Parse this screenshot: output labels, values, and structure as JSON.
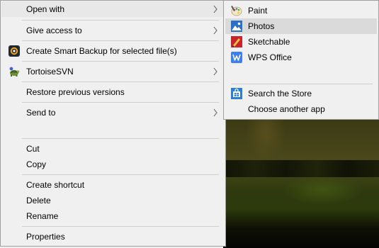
{
  "context_menu": {
    "items": [
      {
        "label": "Open with",
        "has_submenu": true,
        "icon": null,
        "highlighted": true
      },
      {
        "label": "Give access to",
        "has_submenu": true,
        "icon": null
      },
      {
        "label": "Create Smart Backup for selected file(s)",
        "has_submenu": false,
        "icon": "smart-backup-icon"
      },
      {
        "label": "TortoiseSVN",
        "has_submenu": true,
        "icon": "tortoisesvn-icon"
      },
      {
        "label": "Restore previous versions",
        "has_submenu": false,
        "icon": null
      },
      {
        "label": "Send to",
        "has_submenu": true,
        "icon": null
      },
      {
        "label": "Cut",
        "has_submenu": false,
        "icon": null
      },
      {
        "label": "Copy",
        "has_submenu": false,
        "icon": null
      },
      {
        "label": "Create shortcut",
        "has_submenu": false,
        "icon": null
      },
      {
        "label": "Delete",
        "has_submenu": false,
        "icon": null
      },
      {
        "label": "Rename",
        "has_submenu": false,
        "icon": null
      },
      {
        "label": "Properties",
        "has_submenu": false,
        "icon": null
      }
    ]
  },
  "open_with_submenu": {
    "items": [
      {
        "label": "Paint",
        "icon": "paint-icon"
      },
      {
        "label": "Photos",
        "icon": "photos-icon",
        "highlighted": true
      },
      {
        "label": "Sketchable",
        "icon": "sketchable-icon"
      },
      {
        "label": "WPS Office",
        "icon": "wps-office-icon"
      },
      {
        "label": "Search the Store",
        "icon": "store-icon"
      },
      {
        "label": "Choose another app",
        "icon": null
      }
    ]
  },
  "colors": {
    "menu_bg": "#f0f0f0",
    "highlight": "#e8e8e8",
    "submenu_highlight": "#dadada",
    "separator": "#cfcfcf",
    "border": "#a0a0a0"
  }
}
